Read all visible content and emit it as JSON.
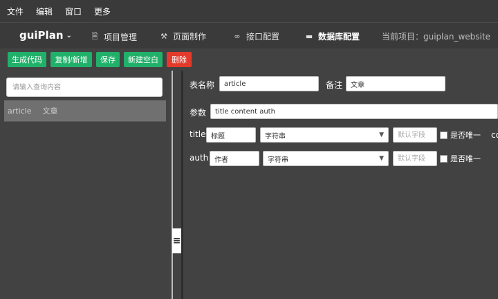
{
  "menu": [
    "文件",
    "编辑",
    "窗口",
    "更多"
  ],
  "nav": {
    "brand": "guiPlan",
    "items": [
      {
        "label": "项目管理",
        "icon": "document-icon"
      },
      {
        "label": "页面制作",
        "icon": "tools-icon"
      },
      {
        "label": "接口配置",
        "icon": "link-icon"
      },
      {
        "label": "数据库配置",
        "icon": "database-icon"
      }
    ],
    "project": "当前项目：guiplan_website"
  },
  "toolbar": {
    "generate": "生成代码",
    "copy_new": "复制/新增",
    "save": "保存",
    "new_blank": "新建空白",
    "delete": "删除"
  },
  "left": {
    "search_placeholder": "请输入查询内容",
    "items": [
      {
        "name": "article",
        "note": "文章"
      }
    ]
  },
  "form": {
    "table_label": "表名称",
    "table_value": "article",
    "note_label": "备注",
    "note_value": "文章",
    "params_label": "参数",
    "params_value": "title content auth",
    "fields": [
      {
        "name": "title",
        "alias": "标题",
        "type": "字符串",
        "default_placeholder": "默认字段",
        "unique_label": "是否唯一"
      },
      {
        "name": "auth",
        "alias": "作者",
        "type": "字符串",
        "default_placeholder": "默认字段",
        "unique_label": "是否唯一"
      }
    ],
    "overflow_label": "co"
  },
  "colors": {
    "bg": "#424242",
    "green": "#21b06a",
    "red": "#e53a2b"
  }
}
